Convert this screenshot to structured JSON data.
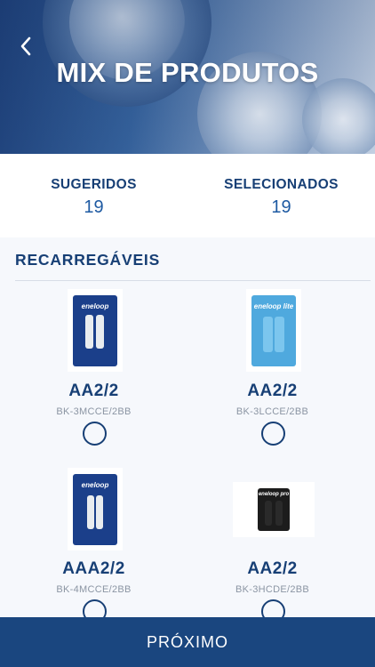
{
  "header": {
    "title": "MIX DE PRODUTOS",
    "back_icon": "chevron-left-icon"
  },
  "counters": {
    "suggested_label": "SUGERIDOS",
    "suggested_value": "19",
    "selected_label": "SELECIONADOS",
    "selected_value": "19"
  },
  "section": {
    "title": "RECARREGÁVEIS"
  },
  "products": [
    {
      "name": "AA2/2",
      "code": "BK-3MCCE/2BB",
      "pack_color": "#1b3f8a",
      "cell_color": "#e9ecef",
      "brand": "eneloop",
      "selected": false
    },
    {
      "name": "AA2/2",
      "code": "BK-3LCCE/2BB",
      "pack_color": "#4fa9de",
      "cell_color": "#7cc6ee",
      "brand": "eneloop lite",
      "selected": false
    },
    {
      "name": "AAA2/2",
      "code": "BK-4MCCE/2BB",
      "pack_color": "#1b3f8a",
      "cell_color": "#e9ecef",
      "brand": "eneloop",
      "selected": false
    },
    {
      "name": "AA2/2",
      "code": "BK-3HCDE/2BB",
      "pack_color": "#1c1c1c",
      "cell_color": "#2a2a2a",
      "brand": "eneloop pro",
      "selected": false
    }
  ],
  "footer": {
    "next_label": "PRÓXIMO"
  },
  "colors": {
    "primary": "#173f75",
    "accent": "#1e5aa2",
    "button": "#1a467f"
  }
}
